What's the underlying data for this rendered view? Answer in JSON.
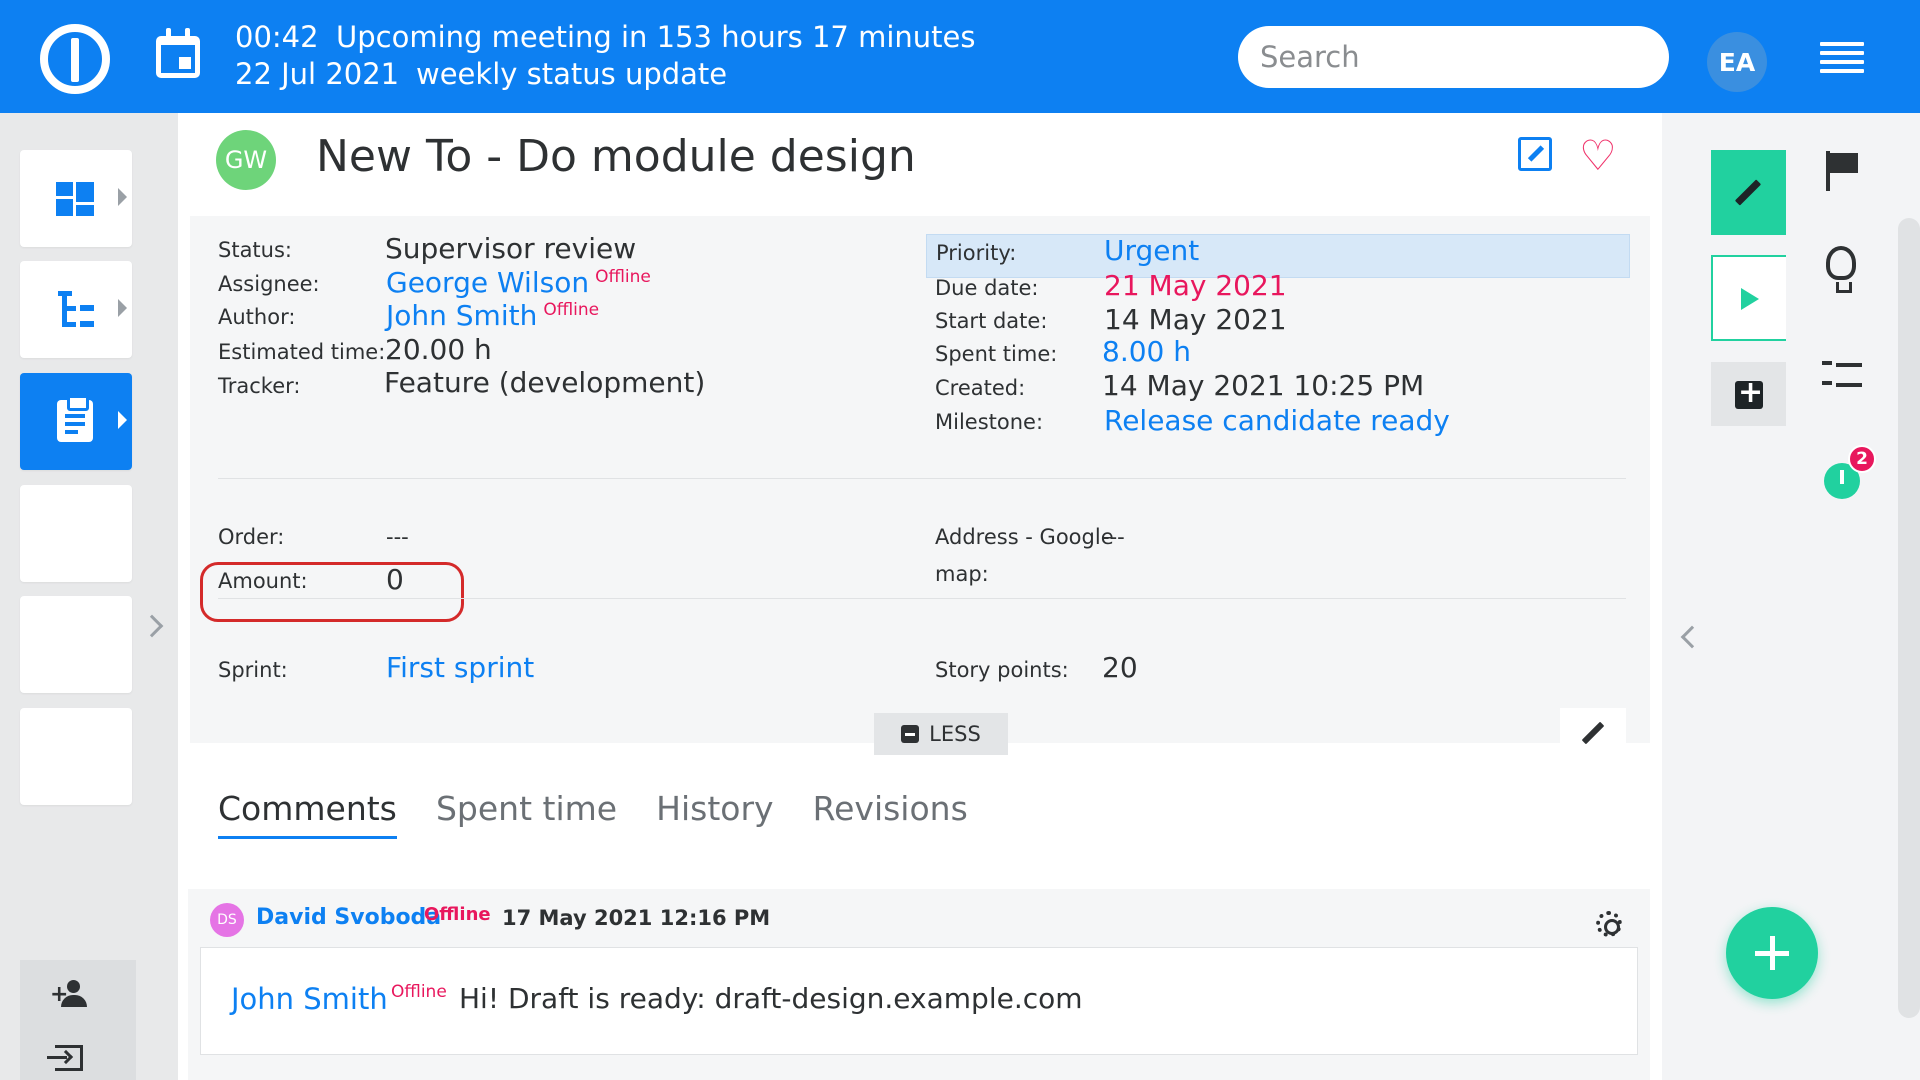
{
  "topbar": {
    "time": "00:42",
    "meeting_message": "Upcoming meeting in 153 hours 17 minutes",
    "date": "22 Jul 2021",
    "meeting_title": "weekly status update",
    "search_placeholder": "Search",
    "user_initials": "EA"
  },
  "task": {
    "assignee_initials": "GW",
    "title": "New To - Do module design"
  },
  "details_left": {
    "status_label": "Status:",
    "status_value": "Supervisor review",
    "assignee_label": "Assignee:",
    "assignee_value": "George Wilson",
    "assignee_presence": "Offline",
    "author_label": "Author:",
    "author_value": "John Smith",
    "author_presence": "Offline",
    "estimated_label": "Estimated time:",
    "estimated_value": "20.00 h",
    "tracker_label": "Tracker:",
    "tracker_value": "Feature (development)"
  },
  "details_right": {
    "priority_label": "Priority:",
    "priority_value": "Urgent",
    "due_label": "Due date:",
    "due_value": "21 May 2021",
    "start_label": "Start date:",
    "start_value": "14 May 2021",
    "spent_label": "Spent time:",
    "spent_value": "8.00 h",
    "created_label": "Created:",
    "created_value": "14 May 2021 10:25 PM",
    "milestone_label": "Milestone:",
    "milestone_value": "Release candidate ready"
  },
  "custom_fields": {
    "order_label": "Order:",
    "order_value": "---",
    "amount_label": "Amount:",
    "amount_value": "0",
    "address_label_line1": "Address - Google",
    "address_label_line2": "map:",
    "address_value": "---",
    "sprint_label": "Sprint:",
    "sprint_value": "First sprint",
    "story_points_label": "Story points:",
    "story_points_value": "20"
  },
  "less_button": "LESS",
  "tabs": [
    "Comments",
    "Spent time",
    "History",
    "Revisions"
  ],
  "comment": {
    "avatar_initials": "DS",
    "author": "David Svoboda",
    "author_presence": "Offline",
    "date": "17 May 2021 12:16 PM",
    "mention": "John Smith",
    "mention_presence": "Offline",
    "text": "Hi! Draft is ready: draft-design.example.com"
  },
  "right_sidebar": {
    "timer_badge": "2"
  },
  "icons": {
    "logo": "easy-logo-icon",
    "calendar": "calendar-icon",
    "menu": "hamburger-menu-icon",
    "edit": "edit-icon",
    "favorite": "heart-icon",
    "gear": "gear-icon",
    "add": "plus-icon"
  },
  "colors": {
    "primary": "#0d80f2",
    "accent_green": "#21d19f",
    "danger": "#e8175d",
    "highlight_ring": "#d42a2a"
  }
}
